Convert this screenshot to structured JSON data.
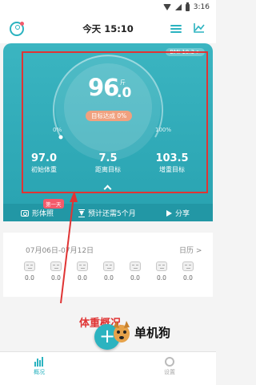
{
  "status_bar": {
    "time": "3:16"
  },
  "header": {
    "title": "今天 15:10",
    "avatar_icon": "user-profile-icon",
    "list_icon": "list-icon",
    "trend_icon": "line-chart-icon"
  },
  "card": {
    "bmi_label": "BMI 18.3 >",
    "weight_int": "96",
    "weight_dec": ".0",
    "unit": "斤",
    "progress_label": "目标达成 0%",
    "pct_start": "0%",
    "pct_end": "100%",
    "stats": [
      {
        "value": "97.0",
        "label": "初始体重"
      },
      {
        "value": "7.5",
        "label": "距离目标"
      },
      {
        "value": "103.5",
        "label": "增重目标"
      }
    ]
  },
  "actions": {
    "photo_label": "形体照",
    "badge": "第一天",
    "estimate_label": "预计还需5个月",
    "share_label": "分享"
  },
  "calendar": {
    "range": "07月06日-07月12日",
    "link": "日历 >",
    "days": [
      "0.0",
      "0.0",
      "0.0",
      "0.0",
      "0.0",
      "0.0",
      "0.0"
    ]
  },
  "annotation": "体重概况",
  "bottom_nav": {
    "left_label": "概况",
    "right_label": "设置",
    "add": "+"
  },
  "watermark": "单机狗",
  "colors": {
    "teal": "#2bb3c0",
    "accent_red": "#e03434",
    "progress": "#f0a17f"
  }
}
